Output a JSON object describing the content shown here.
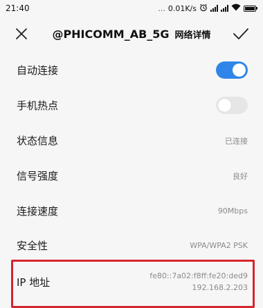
{
  "status_bar": {
    "time": "21:40",
    "dots": "...",
    "net_speed": "0.01K/s",
    "alarm_icon": "alarm-icon",
    "signal_icon": "signal-icon",
    "wifi_icon": "wifi-icon",
    "battery_icon": "battery-icon"
  },
  "header": {
    "ssid": "@PHICOMM_AB_5G",
    "suffix": "网络详情",
    "close_icon": "close-icon",
    "confirm_icon": "check-icon"
  },
  "settings": {
    "auto_connect": {
      "label": "自动连接",
      "enabled": true
    },
    "hotspot": {
      "label": "手机热点",
      "enabled": false
    },
    "status": {
      "label": "状态信息",
      "value": "已连接"
    },
    "signal": {
      "label": "信号强度",
      "value": "良好"
    },
    "speed": {
      "label": "连接速度",
      "value": "90Mbps"
    },
    "security": {
      "label": "安全性",
      "value": "WPA/WPA2 PSK"
    },
    "ip": {
      "label": "IP 地址",
      "ipv6": "fe80::7a02:f8ff:fe20:ded9",
      "ipv4": "192.168.2.203"
    }
  },
  "colors": {
    "toggle_on": "#2f86e8",
    "toggle_off": "#e6e6e6",
    "highlight": "#d6242d",
    "background": "#f6f6f6"
  }
}
